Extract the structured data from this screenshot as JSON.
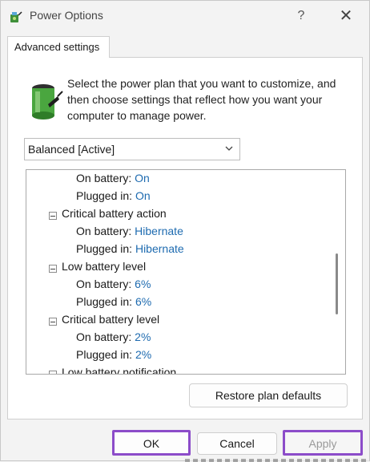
{
  "window": {
    "title": "Power Options",
    "help_label": "?",
    "close_label": "✕"
  },
  "tab": {
    "label": "Advanced settings"
  },
  "description": "Select the power plan that you want to customize, and then choose settings that reflect how you want your computer to manage power.",
  "plan_select": {
    "value": "Balanced [Active]"
  },
  "tree": {
    "rows": [
      {
        "label": "On battery:",
        "value": "On"
      },
      {
        "label": "Plugged in:",
        "value": "On"
      },
      {
        "label": "Critical battery action",
        "value": ""
      },
      {
        "label": "On battery:",
        "value": "Hibernate"
      },
      {
        "label": "Plugged in:",
        "value": "Hibernate"
      },
      {
        "label": "Low battery level",
        "value": ""
      },
      {
        "label": "On battery:",
        "value": "6%"
      },
      {
        "label": "Plugged in:",
        "value": "6%"
      },
      {
        "label": "Critical battery level",
        "value": ""
      },
      {
        "label": "On battery:",
        "value": "2%"
      },
      {
        "label": "Plugged in:",
        "value": "2%"
      },
      {
        "label": "Low battery notification",
        "value": ""
      }
    ]
  },
  "buttons": {
    "restore": "Restore plan defaults",
    "ok": "OK",
    "cancel": "Cancel",
    "apply": "Apply"
  },
  "colors": {
    "highlight_border": "#8c4cc9",
    "value_text": "#1e6bb0"
  },
  "icons": {
    "app": "power-options-icon",
    "panel": "battery-icon",
    "expander": "collapse-minus-icon"
  }
}
